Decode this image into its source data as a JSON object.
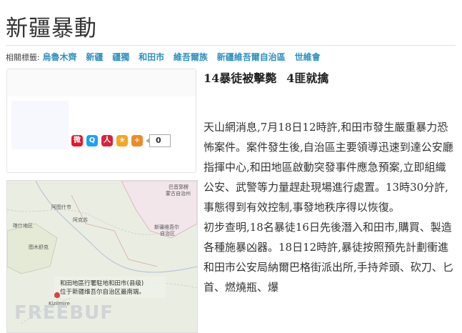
{
  "page": {
    "title": "新疆暴動",
    "tags_label": "相關標籤:",
    "tags": [
      "烏魯木齊",
      "新疆",
      "疆獨",
      "和田市",
      "維吾爾族",
      "新疆維吾爾自治區",
      "世維會"
    ]
  },
  "share": {
    "count": "0",
    "icons": [
      "weibo-icon",
      "qq-icon",
      "renren-icon",
      "favorite-star-icon",
      "plus-share-icon"
    ],
    "colors": {
      "weibo": "#e6162d",
      "qq": "#1da1f2",
      "renren": "#d9233d",
      "star": "#f5a623",
      "plus": "#f08a24"
    }
  },
  "map": {
    "caption_line1": "和田地區行署駐地和田市(县级)",
    "caption_line2": "位于新疆维吾尔自治区最南端。",
    "labels": [
      "阿图什市",
      "巴音郭楞",
      "蒙古自治州",
      "阿克苏",
      "喀什地区",
      "新疆维吾尔",
      "自治区",
      "图木舒克",
      "Kizilmire"
    ],
    "watermark": "FREEBUF"
  },
  "article": {
    "headline_part1": "14暴徒被擊斃",
    "headline_part2": "4匪就擒",
    "paragraphs": [
      "天山網消息,7月18日12時許,和田市發生嚴重暴力恐怖案件。案件發生後,自治區主要領導迅速到達公安廳指揮中心,和田地區啟動突發事件應急預案,立即組織公安、武警等力量趕赴現場進行處置。13時30分許,事態得到有效控制,事發地秩序得以恢復。",
      "初步查明,18名暴徒16日先後潛入和田市,購買、製造各種施暴凶器。18日12時許,暴徒按照預先計劃衝進和田市公安局納爾巴格街派出所,手持斧頭、砍刀、匕首、燃燒瓶、爆"
    ]
  }
}
